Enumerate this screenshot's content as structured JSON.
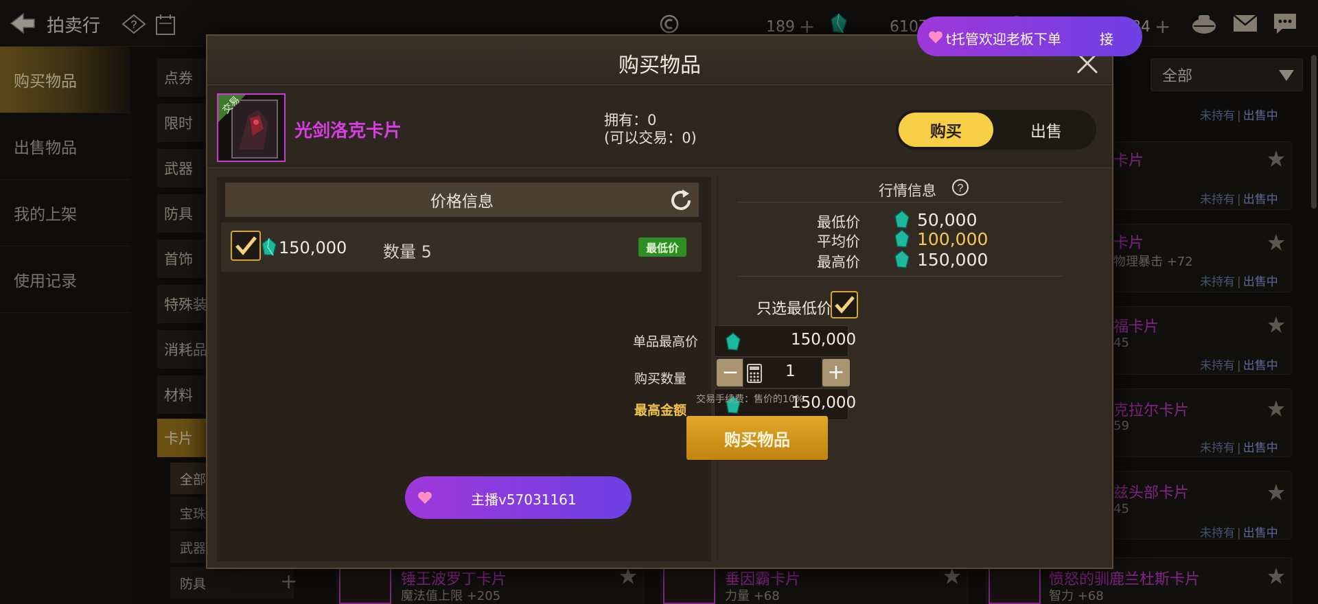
{
  "header": {
    "title": "拍卖行",
    "currency1": {
      "value": "189",
      "plus": "+"
    },
    "currency2": {
      "value": "610万5083",
      "plus": "+"
    },
    "currency3": {
      "value": "183万5284",
      "plus": "+"
    }
  },
  "sidebar": {
    "items": [
      {
        "label": "购买物品"
      },
      {
        "label": "出售物品"
      },
      {
        "label": "我的上架"
      },
      {
        "label": "使用记录"
      }
    ]
  },
  "categories": [
    "点券",
    "限时",
    "武器",
    "防具",
    "首饰",
    "特殊装",
    "消耗品",
    "材料",
    "卡片"
  ],
  "subcategories": {
    "items": [
      "全部",
      "宝珠",
      "武器",
      "防具"
    ],
    "plus": "+"
  },
  "filter": {
    "label": "全部"
  },
  "background_list": [
    {
      "title": "卡片",
      "sub": ""
    },
    {
      "title": "卡片",
      "sub": "物理暴击 +72"
    },
    {
      "title": "福卡片",
      "sub": "45"
    },
    {
      "title": "克拉尔卡片",
      "sub": "59"
    },
    {
      "title": "兹头部卡片",
      "sub": "45"
    }
  ],
  "background_bottom": [
    {
      "title": "锤王波罗丁卡片",
      "sub": "魔法值上限 +205"
    },
    {
      "title": "垂因霸卡片",
      "sub": "力量 +68"
    },
    {
      "title": "愤怒的驯鹿兰杜斯卡片",
      "sub": "智力 +68"
    }
  ],
  "status": {
    "not_owned": "未持有",
    "sep": "|",
    "on_sale": "出售中"
  },
  "modal": {
    "title": "购买物品",
    "item": {
      "name": "光剑洛克卡片",
      "tag": "交易"
    },
    "owned_line1": "拥有：0",
    "owned_line2": "(可以交易：0)",
    "tabs": {
      "buy": "购买",
      "sell": "出售"
    },
    "price_header": "价格信息",
    "price_row": {
      "price": "150,000",
      "qty_label": "数量",
      "qty": "5",
      "badge": "最低价"
    },
    "market": {
      "title": "行情信息",
      "min_label": "最低价",
      "min": "50,000",
      "avg_label": "平均价",
      "avg": "100,000",
      "max_label": "最高价",
      "max": "150,000"
    },
    "only_lowest": "只选最低价",
    "form": {
      "unit_max_label": "单品最高价",
      "unit_max": "150,000",
      "qty_label": "购买数量",
      "qty": "1",
      "minus": "−",
      "plus": "+",
      "total_label": "最高金额",
      "total": "150,000"
    },
    "fee": "交易手续费：售价的10%",
    "buy_button": "购买物品"
  },
  "overlays": {
    "top_banner": "t托管欢迎老板下单",
    "top_banner_action": "接",
    "host": "主播v57031161"
  },
  "colors": {
    "gold": "#f7cf47",
    "item_purple": "#d63ee0",
    "badge_green": "#2f8d25",
    "buy_button": "#c18410"
  }
}
